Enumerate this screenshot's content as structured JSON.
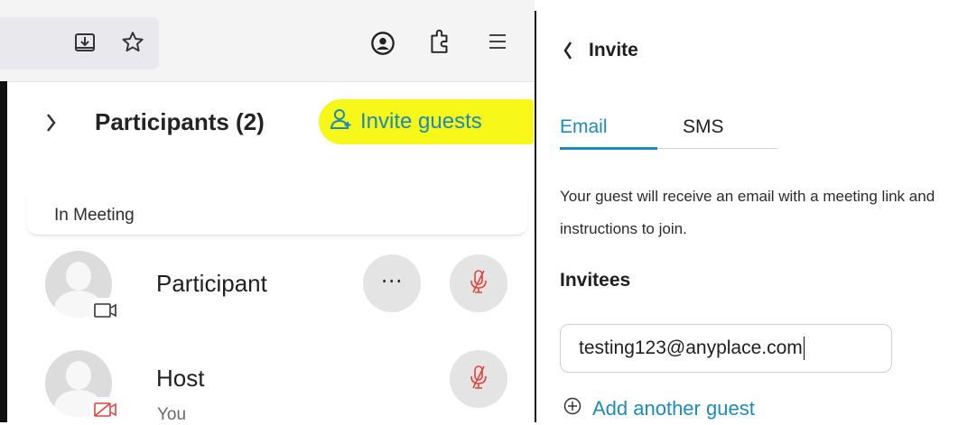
{
  "participants_panel": {
    "title": "Participants (2)",
    "invite_label": "Invite guests",
    "section_label": "In Meeting",
    "participants": [
      {
        "name": "Participant",
        "subtitle": "",
        "video": "on",
        "muted": true,
        "has_more_menu": true
      },
      {
        "name": "Host",
        "subtitle": "You",
        "video": "off",
        "muted": true,
        "has_more_menu": false
      }
    ],
    "more_label": "⋯"
  },
  "invite_panel": {
    "title": "Invite",
    "tabs": [
      {
        "label": "Email",
        "active": true
      },
      {
        "label": "SMS",
        "active": false
      }
    ],
    "description": "Your guest will receive an email with a meeting link and instructions to join.",
    "invitees_label": "Invitees",
    "email_value": "testing123@anyplace.com",
    "add_guest_label": "Add another guest"
  },
  "colors": {
    "accent": "#1b8cbb",
    "highlight": "#f7f719",
    "muted_red": "#e0453a"
  }
}
